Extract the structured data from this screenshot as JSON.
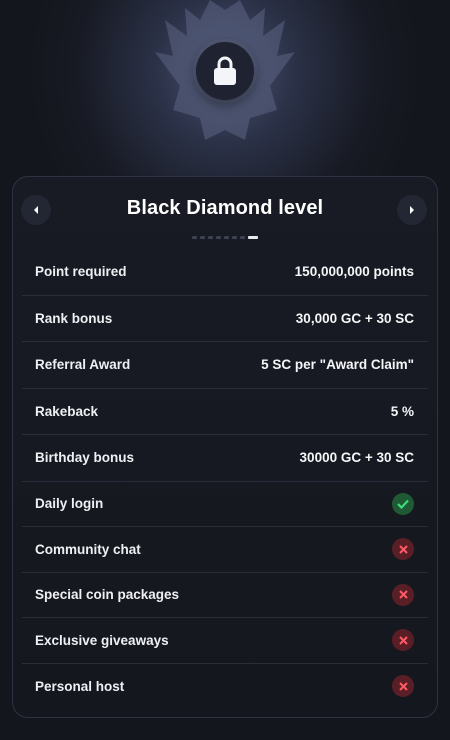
{
  "level": {
    "title": "Black Diamond level",
    "pager_total": 8,
    "pager_active": 7
  },
  "rows": [
    {
      "label": "Point required",
      "value": "150,000,000 points"
    },
    {
      "label": "Rank bonus",
      "value": "30,000 GC + 30 SC"
    },
    {
      "label": "Referral Award",
      "value": "5 SC per \"Award Claim\""
    },
    {
      "label": "Rakeback",
      "value": "5 %"
    },
    {
      "label": "Birthday bonus",
      "value": "30000 GC + 30 SC"
    }
  ],
  "perks": [
    {
      "label": "Daily login",
      "included": true
    },
    {
      "label": "Community chat",
      "included": false
    },
    {
      "label": "Special coin packages",
      "included": false
    },
    {
      "label": "Exclusive giveaways",
      "included": false
    },
    {
      "label": "Personal host",
      "included": false
    }
  ],
  "icons": {
    "emblem": "winged-shield-emblem",
    "lock": "lock-icon",
    "prev": "chevron-left-icon",
    "next": "chevron-right-icon",
    "yes": "check-icon",
    "no": "x-icon"
  },
  "colors": {
    "yes_bg": "#1f5a35",
    "yes_fg": "#3ddc7a",
    "no_bg": "#5a1f26",
    "no_fg": "#ff5a63"
  }
}
